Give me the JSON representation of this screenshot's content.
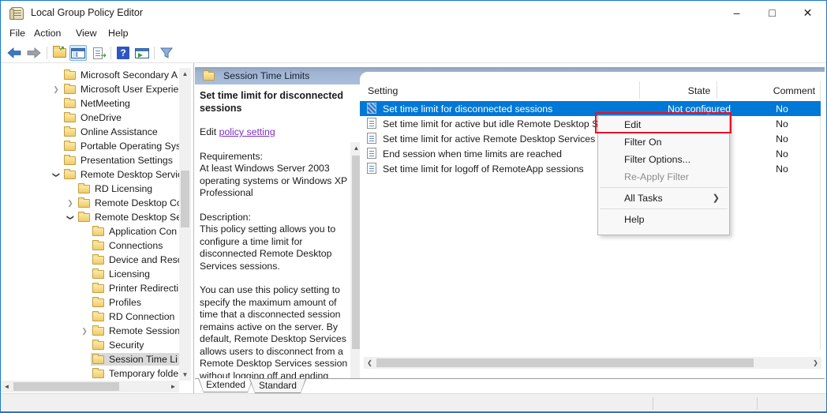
{
  "window": {
    "title": "Local Group Policy Editor",
    "controls": {
      "minimize": "–",
      "maximize": "□",
      "close": "✕"
    }
  },
  "menu_bar": {
    "items": [
      "File",
      "Action",
      "View",
      "Help"
    ]
  },
  "toolbar": {
    "icons": [
      "back",
      "forward",
      "up-one-level",
      "show-console-tree",
      "export-list",
      "help",
      "show-action-pane",
      "filter"
    ],
    "active_icon": "show-console-tree"
  },
  "tree": {
    "items": [
      {
        "label": "Microsoft Secondary A",
        "level": 0,
        "chevron": "none",
        "selected": false
      },
      {
        "label": "Microsoft User Experien",
        "level": 0,
        "chevron": "collapsed",
        "selected": false
      },
      {
        "label": "NetMeeting",
        "level": 0,
        "chevron": "none",
        "selected": false
      },
      {
        "label": "OneDrive",
        "level": 0,
        "chevron": "none",
        "selected": false
      },
      {
        "label": "Online Assistance",
        "level": 0,
        "chevron": "none",
        "selected": false
      },
      {
        "label": "Portable Operating Sys",
        "level": 0,
        "chevron": "none",
        "selected": false
      },
      {
        "label": "Presentation Settings",
        "level": 0,
        "chevron": "none",
        "selected": false
      },
      {
        "label": "Remote Desktop Servic",
        "level": 0,
        "chevron": "expanded",
        "selected": false
      },
      {
        "label": "RD Licensing",
        "level": 1,
        "chevron": "none",
        "selected": false
      },
      {
        "label": "Remote Desktop Co",
        "level": 1,
        "chevron": "collapsed",
        "selected": false
      },
      {
        "label": "Remote Desktop Se",
        "level": 1,
        "chevron": "expanded",
        "selected": false
      },
      {
        "label": "Application Con",
        "level": 2,
        "chevron": "none",
        "selected": false
      },
      {
        "label": "Connections",
        "level": 2,
        "chevron": "none",
        "selected": false
      },
      {
        "label": "Device and Reso",
        "level": 2,
        "chevron": "none",
        "selected": false
      },
      {
        "label": "Licensing",
        "level": 2,
        "chevron": "none",
        "selected": false
      },
      {
        "label": "Printer Redirecti",
        "level": 2,
        "chevron": "none",
        "selected": false
      },
      {
        "label": "Profiles",
        "level": 2,
        "chevron": "none",
        "selected": false
      },
      {
        "label": "RD Connection",
        "level": 2,
        "chevron": "none",
        "selected": false
      },
      {
        "label": "Remote Session",
        "level": 2,
        "chevron": "collapsed",
        "selected": false
      },
      {
        "label": "Security",
        "level": 2,
        "chevron": "none",
        "selected": false
      },
      {
        "label": "Session Time Li",
        "level": 2,
        "chevron": "none",
        "selected": true
      },
      {
        "label": "Temporary folde",
        "level": 2,
        "chevron": "none",
        "selected": false
      }
    ]
  },
  "content_header": {
    "title": "Session Time Limits"
  },
  "extended_pane": {
    "policy_title": "Set time limit for disconnected sessions",
    "edit_prefix": "Edit ",
    "edit_link": "policy setting",
    "requirements_label": "Requirements:",
    "requirements_text": "At least Windows Server 2003 operating systems or Windows XP Professional",
    "description_label": "Description:",
    "description_p1": "This policy setting allows you to configure a time limit for disconnected Remote Desktop Services sessions.",
    "description_p2": "You can use this policy setting to specify the maximum amount of time that a disconnected session remains active on the server. By default, Remote Desktop Services allows users to disconnect from a Remote Desktop Services session without logging off and ending"
  },
  "list": {
    "columns": [
      "Setting",
      "State",
      "Comment"
    ],
    "rows": [
      {
        "setting": "Set time limit for disconnected sessions",
        "state": "Not configured",
        "comment": "No",
        "selected": true
      },
      {
        "setting": "Set time limit for active but idle Remote Desktop Services sessions",
        "state": "",
        "comment": "No",
        "selected": false
      },
      {
        "setting": "Set time limit for active Remote Desktop Services sessions",
        "state": "",
        "comment": "No",
        "selected": false
      },
      {
        "setting": "End session when time limits are reached",
        "state": "",
        "comment": "No",
        "selected": false
      },
      {
        "setting": "Set time limit for logoff of RemoteApp sessions",
        "state": "",
        "comment": "No",
        "selected": false
      }
    ]
  },
  "context_menu": {
    "items": [
      {
        "label": "Edit",
        "highlighted": true
      },
      {
        "label": "Filter On"
      },
      {
        "label": "Filter Options..."
      },
      {
        "label": "Re-Apply Filter",
        "disabled": true
      },
      {
        "label": "All Tasks",
        "submenu": true
      },
      {
        "label": "Help"
      }
    ],
    "submenu_arrow": "❯"
  },
  "tabs": {
    "items": [
      "Extended",
      "Standard"
    ],
    "active": "Extended"
  },
  "colors": {
    "selection_blue": "#0078d7",
    "annotation_red": "#e81123",
    "link_purple": "#7b2fbf",
    "header_band_blue": "#9fb4d2",
    "tree_selection_gray": "#d9d9d9",
    "window_border_blue": "#1779d2"
  }
}
